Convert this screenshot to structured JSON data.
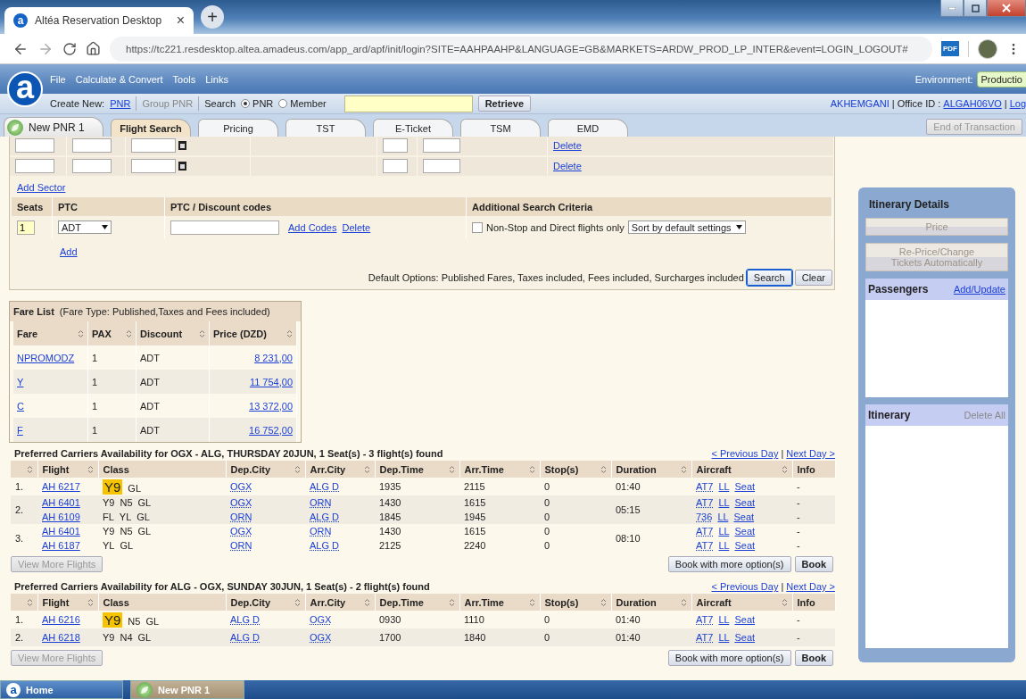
{
  "browser": {
    "favicon": "a",
    "tab_title": "Altéa Reservation Desktop",
    "close": "×",
    "new_tab": "+",
    "url": "https://tc221.resdesktop.altea.amadeus.com/app_ard/apf/init/login?SITE=AAHPAAHP&LANGUAGE=GB&MARKETS=ARDW_PROD_LP_INTER&event=LOGIN_LOGOUT#",
    "pdf": "PDF"
  },
  "app": {
    "logo": "a",
    "menu": [
      "File",
      "Calculate & Convert",
      "Tools",
      "Links"
    ],
    "environment_label": "Environment:",
    "environment": "Productio",
    "create_new_label": "Create New:",
    "create_pnr": "PNR",
    "group_pnr": {
      "label": "Group PNR",
      "disabled": true
    },
    "search_label": "Search",
    "search_options": [
      {
        "label": "PNR",
        "selected": true
      },
      {
        "label": "Member",
        "selected": false
      }
    ],
    "retrieve": "Retrieve",
    "user": "AKHEMGANI",
    "office_label": "| Office ID :",
    "office_id": "ALGAH06VO",
    "separator": "|",
    "logout": "Log"
  },
  "pnr_tab": {
    "label": "New PNR 1"
  },
  "tabs": [
    {
      "label": "Flight Search",
      "selected": true
    },
    {
      "label": "Pricing",
      "selected": false
    },
    {
      "label": "TST",
      "selected": false
    },
    {
      "label": "E-Ticket",
      "selected": false
    },
    {
      "label": "TSM",
      "selected": false
    },
    {
      "label": "EMD",
      "selected": false
    }
  ],
  "end_transaction": {
    "label": "End of Transaction",
    "disabled": true
  },
  "sectors": {
    "rows": [
      {
        "delete": "Delete"
      },
      {
        "delete": "Delete"
      }
    ],
    "add_sector": "Add Sector"
  },
  "passengers_form": {
    "columns": [
      "Seats",
      "PTC",
      "PTC / Discount codes",
      "Additional Search Criteria"
    ],
    "seats": "1",
    "ptc": "ADT",
    "add_codes": "Add Codes",
    "delete": "Delete",
    "nonstop": {
      "label": "Non-Stop and Direct flights only",
      "checked": false
    },
    "sort": "Sort by default settings",
    "add": "Add"
  },
  "default_options": "Default Options: Published Fares, Taxes included, Fees included, Surcharges included",
  "search_button": "Search",
  "clear_button": "Clear",
  "fare_list": {
    "title": "Fare List",
    "subtitle": "(Fare Type: Published,Taxes and Fees included)",
    "columns": [
      "Fare",
      "PAX",
      "Discount",
      "Price (DZD)"
    ],
    "rows": [
      {
        "fare": "NPROMODZ",
        "pax": "1",
        "discount": "ADT",
        "price": "8 231,00"
      },
      {
        "fare": "Y",
        "pax": "1",
        "discount": "ADT",
        "price": "11 754,00"
      },
      {
        "fare": "C",
        "pax": "1",
        "discount": "ADT",
        "price": "13 372,00"
      },
      {
        "fare": "F",
        "pax": "1",
        "discount": "ADT",
        "price": "16 752,00"
      }
    ]
  },
  "availability": [
    {
      "title": "Preferred Carriers Availability for OGX - ALG, THURSDAY 20JUN, 1 Seat(s) - 3 flight(s) found",
      "previous": "< Previous Day",
      "separator": "|",
      "next": "Next Day >",
      "columns": [
        {
          "label": "Flight",
          "sortable": true
        },
        {
          "label": "Class",
          "sortable": false
        },
        {
          "label": "Dep.City",
          "sortable": true
        },
        {
          "label": "Arr.City",
          "sortable": true
        },
        {
          "label": "Dep.Time",
          "sortable": true
        },
        {
          "label": "Arr.Time",
          "sortable": true
        },
        {
          "label": "Stop(s)",
          "sortable": true
        },
        {
          "label": "Duration",
          "sortable": true
        },
        {
          "label": "Aircraft",
          "sortable": true
        },
        {
          "label": "Info",
          "sortable": false
        }
      ],
      "options": [
        {
          "number": "1.",
          "duration": "01:40",
          "segments": [
            {
              "flight": "AH 6217",
              "classes": [
                {
                  "code": "Y9",
                  "highlighted": true
                },
                {
                  "code": "GL",
                  "highlighted": false
                }
              ],
              "dep_city": "OGX",
              "arr_city": "ALG D",
              "dep_time": "1935",
              "arr_time": "2115",
              "stops": "0",
              "aircraft": "AT7",
              "ll": "LL",
              "seat": "Seat",
              "info": "-"
            }
          ]
        },
        {
          "number": "2.",
          "duration": "05:15",
          "segments": [
            {
              "flight": "AH 6401",
              "classes": [
                {
                  "code": "Y9",
                  "highlighted": false
                },
                {
                  "code": "N5",
                  "highlighted": false
                },
                {
                  "code": "GL",
                  "highlighted": false
                }
              ],
              "dep_city": "OGX",
              "arr_city": "ORN",
              "dep_time": "1430",
              "arr_time": "1615",
              "stops": "0",
              "aircraft": "AT7",
              "ll": "LL",
              "seat": "Seat",
              "info": "-"
            },
            {
              "flight": "AH 6109",
              "classes": [
                {
                  "code": "FL",
                  "highlighted": false
                },
                {
                  "code": "YL",
                  "highlighted": false
                },
                {
                  "code": "GL",
                  "highlighted": false
                }
              ],
              "dep_city": "ORN",
              "arr_city": "ALG D",
              "dep_time": "1845",
              "arr_time": "1945",
              "stops": "0",
              "aircraft": "736",
              "ll": "LL",
              "seat": "Seat",
              "info": "-"
            }
          ]
        },
        {
          "number": "3.",
          "duration": "08:10",
          "segments": [
            {
              "flight": "AH 6401",
              "classes": [
                {
                  "code": "Y9",
                  "highlighted": false
                },
                {
                  "code": "N5",
                  "highlighted": false
                },
                {
                  "code": "GL",
                  "highlighted": false
                }
              ],
              "dep_city": "OGX",
              "arr_city": "ORN",
              "dep_time": "1430",
              "arr_time": "1615",
              "stops": "0",
              "aircraft": "AT7",
              "ll": "LL",
              "seat": "Seat",
              "info": "-"
            },
            {
              "flight": "AH 6187",
              "classes": [
                {
                  "code": "YL",
                  "highlighted": false
                },
                {
                  "code": "GL",
                  "highlighted": false
                }
              ],
              "dep_city": "ORN",
              "arr_city": "ALG D",
              "dep_time": "2125",
              "arr_time": "2240",
              "stops": "0",
              "aircraft": "AT7",
              "ll": "LL",
              "seat": "Seat",
              "info": "-"
            }
          ]
        }
      ],
      "view_more": {
        "label": "View More Flights",
        "disabled": true
      },
      "book_more": "Book with more option(s)",
      "book": "Book"
    },
    {
      "title": "Preferred Carriers Availability for ALG - OGX, SUNDAY 30JUN, 1 Seat(s) - 2 flight(s) found",
      "previous": "< Previous Day",
      "separator": "|",
      "next": "Next Day >",
      "columns": [
        {
          "label": "Flight",
          "sortable": true
        },
        {
          "label": "Class",
          "sortable": false
        },
        {
          "label": "Dep.City",
          "sortable": true
        },
        {
          "label": "Arr.City",
          "sortable": true
        },
        {
          "label": "Dep.Time",
          "sortable": true
        },
        {
          "label": "Arr.Time",
          "sortable": true
        },
        {
          "label": "Stop(s)",
          "sortable": true
        },
        {
          "label": "Duration",
          "sortable": true
        },
        {
          "label": "Aircraft",
          "sortable": true
        },
        {
          "label": "Info",
          "sortable": false
        }
      ],
      "options": [
        {
          "number": "1.",
          "duration": "01:40",
          "segments": [
            {
              "flight": "AH 6216",
              "classes": [
                {
                  "code": "Y9",
                  "highlighted": true
                },
                {
                  "code": "N5",
                  "highlighted": false
                },
                {
                  "code": "GL",
                  "highlighted": false
                }
              ],
              "dep_city": "ALG D",
              "arr_city": "OGX",
              "dep_time": "0930",
              "arr_time": "1110",
              "stops": "0",
              "aircraft": "AT7",
              "ll": "LL",
              "seat": "Seat",
              "info": "-"
            }
          ]
        },
        {
          "number": "2.",
          "duration": "01:40",
          "segments": [
            {
              "flight": "AH 6218",
              "classes": [
                {
                  "code": "Y9",
                  "highlighted": false
                },
                {
                  "code": "N4",
                  "highlighted": false
                },
                {
                  "code": "GL",
                  "highlighted": false
                }
              ],
              "dep_city": "ALG D",
              "arr_city": "OGX",
              "dep_time": "1700",
              "arr_time": "1840",
              "stops": "0",
              "aircraft": "AT7",
              "ll": "LL",
              "seat": "Seat",
              "info": "-"
            }
          ]
        }
      ],
      "view_more": {
        "label": "View More Flights",
        "disabled": true
      },
      "book_more": "Book with more option(s)",
      "book": "Book"
    }
  ],
  "itinerary_panel": {
    "title": "Itinerary Details",
    "price": {
      "label": "Price",
      "disabled": true
    },
    "reprice": {
      "label": "Re-Price/Change Tickets Automatically",
      "disabled": true
    },
    "passengers": "Passengers",
    "add_update": "Add/Update",
    "itinerary": "Itinerary",
    "delete_all": {
      "label": "Delete All",
      "disabled": true
    }
  },
  "taskbar": [
    {
      "label": "Home",
      "icon": "a",
      "kind": "home",
      "selected": false
    },
    {
      "label": "New PNR 1",
      "kind": "pnr",
      "selected": true
    }
  ]
}
